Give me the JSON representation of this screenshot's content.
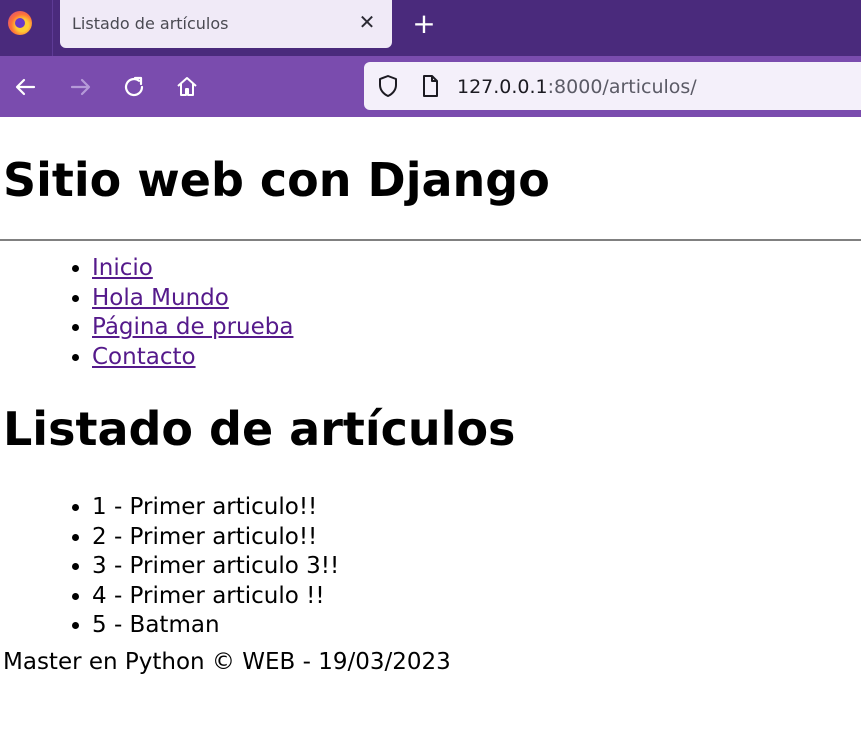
{
  "browser": {
    "tab_title": "Listado de artículos",
    "url_host": "127.0.0.1",
    "url_path": ":8000/articulos/",
    "colors": {
      "tabbar": "#4a2a7c",
      "toolbar": "#7a4cae",
      "active_tab": "#f0eaf7"
    },
    "icons": [
      "firefox-icon",
      "close-icon",
      "plus-icon",
      "back-arrow-icon",
      "forward-arrow-icon",
      "reload-icon",
      "home-icon",
      "shield-icon",
      "page-icon"
    ]
  },
  "site": {
    "title": "Sitio web con Django",
    "menu": [
      {
        "label": "Inicio"
      },
      {
        "label": "Hola Mundo"
      },
      {
        "label": "Página de prueba"
      },
      {
        "label": "Contacto"
      }
    ]
  },
  "content": {
    "heading": "Listado de artículos",
    "articles": [
      {
        "text": "1 - Primer articulo!!"
      },
      {
        "text": "2 - Primer articulo!!"
      },
      {
        "text": "3 - Primer articulo 3!!"
      },
      {
        "text": "4 - Primer articulo !!"
      },
      {
        "text": "5 - Batman"
      }
    ]
  },
  "footer": {
    "text": "Master en Python © WEB - 19/03/2023"
  },
  "colors": {
    "link": "#551a8b",
    "rule": "#808080"
  }
}
